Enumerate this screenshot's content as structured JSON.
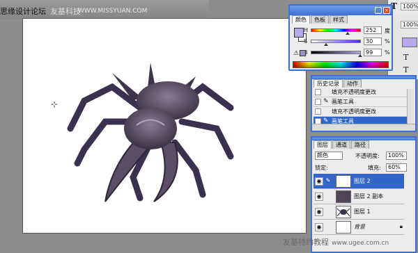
{
  "watermark_top": {
    "brand": "思缘设计论坛",
    "overlay": "友基科技",
    "site": "WWW.MISSYUAN.COM"
  },
  "toolbar_right": {
    "tool_glyph": "T",
    "top_value": "100%",
    "second_value": "100%",
    "glyphs": [
      "T",
      "T",
      "T"
    ]
  },
  "color_panel": {
    "tabs": [
      "颜色",
      "色板",
      "样式"
    ],
    "rows": [
      {
        "label": "H",
        "value": "252",
        "unit": "度",
        "thumb": 0.7
      },
      {
        "label": "S",
        "value": "30",
        "unit": "%",
        "thumb": 0.3
      },
      {
        "label": "B",
        "value": "99",
        "unit": "%",
        "thumb": 0.99
      }
    ],
    "foreground": "#b7a8ea",
    "background": "#ffffff"
  },
  "history_panel": {
    "tabs": [
      "历史记录",
      "动作"
    ],
    "items": [
      {
        "icon": "fill-icon",
        "text": "填充不透明度更改",
        "selected": false
      },
      {
        "icon": "brush-icon",
        "text": "画笔工具",
        "selected": false
      },
      {
        "icon": "fill-icon",
        "text": "填充不透明度更改",
        "selected": false
      },
      {
        "icon": "brush-icon",
        "text": "画笔工具",
        "selected": true
      }
    ]
  },
  "layers_panel": {
    "tabs": [
      "图层",
      "通道",
      "路径"
    ],
    "blend_mode": "颜色",
    "opacity_label": "不透明度:",
    "opacity_value": "100%",
    "lock_label": "锁定:",
    "fill_label": "填充:",
    "fill_value": "60%",
    "layers": [
      {
        "name": "图层 2",
        "selected": true,
        "thumb": "checker"
      },
      {
        "name": "图层 2 副本",
        "selected": false,
        "thumb": "dark"
      },
      {
        "name": "图层 1",
        "selected": false,
        "thumb": "spider"
      },
      {
        "name": "背景",
        "selected": false,
        "thumb": "white",
        "locked": true
      }
    ]
  },
  "watermark_bottom": {
    "text": "友基特约教程",
    "url": "www.ugee.com.cn"
  },
  "colors": {
    "title_blue": "#3a6fd8",
    "selection_blue": "#3166c8",
    "spider_body": "#4a4050"
  }
}
